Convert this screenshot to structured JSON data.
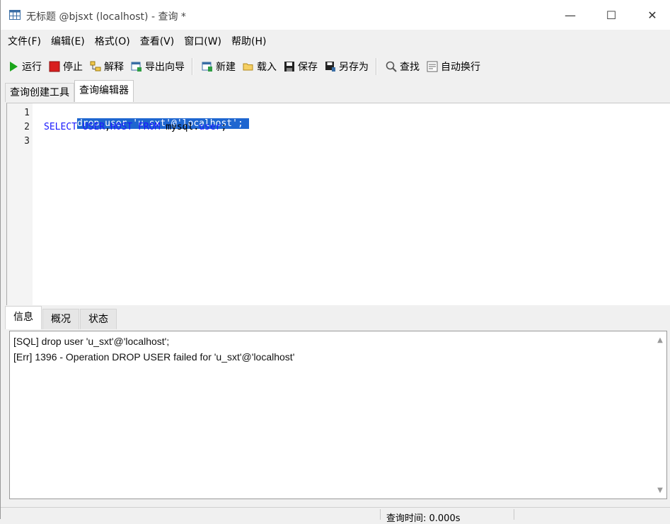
{
  "window": {
    "title": "无标题 @bjsxt (localhost) - 查询 *",
    "minimize_glyph": "—",
    "maximize_glyph": "☐",
    "close_glyph": "✕"
  },
  "menu": [
    {
      "label": "文件(F)"
    },
    {
      "label": "编辑(E)"
    },
    {
      "label": "格式(O)"
    },
    {
      "label": "查看(V)"
    },
    {
      "label": "窗口(W)"
    },
    {
      "label": "帮助(H)"
    }
  ],
  "toolbar": {
    "run": {
      "label": "运行",
      "icon": "play-icon",
      "color": "#1aa51a"
    },
    "stop": {
      "label": "停止",
      "icon": "stop-icon",
      "color": "#d81f1f"
    },
    "explain": {
      "label": "解释",
      "icon": "explain-icon"
    },
    "export": {
      "label": "导出向导",
      "icon": "export-icon"
    },
    "new": {
      "label": "新建",
      "icon": "new-query-icon"
    },
    "load": {
      "label": "载入",
      "icon": "folder-icon"
    },
    "save": {
      "label": "保存",
      "icon": "save-icon"
    },
    "save_as": {
      "label": "另存为",
      "icon": "save-as-icon"
    },
    "find": {
      "label": "查找",
      "icon": "search-icon"
    },
    "wrap": {
      "label": "自动换行",
      "icon": "word-wrap-icon"
    }
  },
  "editor_tabs": [
    {
      "label": "查询创建工具",
      "active": false
    },
    {
      "label": "查询编辑器",
      "active": true
    }
  ],
  "editor": {
    "lines": [
      {
        "no": "1",
        "text": "drop user 'u sxt'@'localhost'; ",
        "selected": true
      },
      {
        "no": "2",
        "parts": {
          "kw1": "SELECT USER",
          "p1": ",",
          "kw2": "HOST",
          "p2": " ",
          "kw3": "FROM",
          "p3": " mysql.",
          "kw4": "user",
          "p4": ";"
        }
      },
      {
        "no": "3",
        "text": ""
      }
    ]
  },
  "result_tabs": [
    {
      "label": "信息",
      "active": true
    },
    {
      "label": "概况",
      "active": false
    },
    {
      "label": "状态",
      "active": false
    }
  ],
  "messages": [
    "[SQL] drop user 'u_sxt'@'localhost';",
    "[Err] 1396 - Operation DROP USER failed for 'u_sxt'@'localhost'"
  ],
  "status": {
    "query_time": "查询时间: 0.000s"
  },
  "colors": {
    "selection": "#1e66d0",
    "keyword": "#1a1aff"
  }
}
